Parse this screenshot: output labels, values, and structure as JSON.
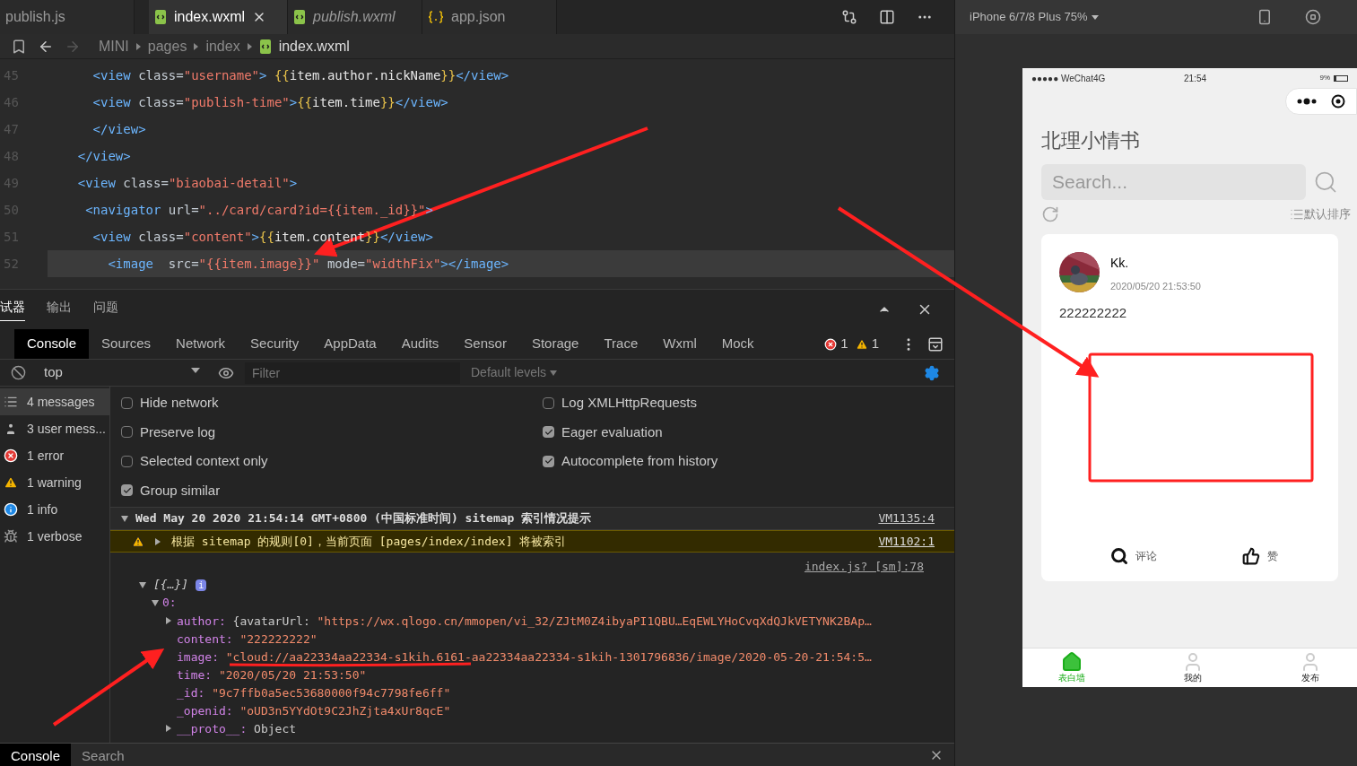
{
  "editor_tabs": [
    {
      "label": "publish.js",
      "kind": "js",
      "selected": false,
      "preview": false
    },
    {
      "label": "index.wxml",
      "kind": "wxml",
      "selected": true,
      "preview": false
    },
    {
      "label": "publish.wxml",
      "kind": "wxml",
      "selected": false,
      "preview": true
    },
    {
      "label": "app.json",
      "kind": "json",
      "selected": false,
      "preview": false
    }
  ],
  "breadcrumb": [
    "MINI",
    "pages",
    "index",
    "index.wxml"
  ],
  "code_lines": [
    {
      "number": "45",
      "highlighted": false,
      "segments": [
        {
          "text": "      <view",
          "kind": "tag"
        },
        {
          "text": " class=",
          "kind": "attr"
        },
        {
          "text": "\"username\"",
          "kind": "str"
        },
        {
          "text": "> ",
          "kind": "tag"
        },
        {
          "text": "{{",
          "kind": "brace"
        },
        {
          "text": "item.author.nickName",
          "kind": "plain"
        },
        {
          "text": "}}",
          "kind": "brace"
        },
        {
          "text": "</view>",
          "kind": "tag"
        }
      ]
    },
    {
      "number": "46",
      "highlighted": false,
      "segments": [
        {
          "text": "      <view",
          "kind": "tag"
        },
        {
          "text": " class=",
          "kind": "attr"
        },
        {
          "text": "\"publish-time\"",
          "kind": "str"
        },
        {
          "text": ">",
          "kind": "tag"
        },
        {
          "text": "{{",
          "kind": "brace"
        },
        {
          "text": "item.time",
          "kind": "plain"
        },
        {
          "text": "}}",
          "kind": "brace"
        },
        {
          "text": "</view>",
          "kind": "tag"
        }
      ]
    },
    {
      "number": "47",
      "highlighted": false,
      "segments": [
        {
          "text": "      </view>",
          "kind": "tag"
        }
      ]
    },
    {
      "number": "48",
      "highlighted": false,
      "segments": [
        {
          "text": "    </view>",
          "kind": "tag"
        }
      ]
    },
    {
      "number": "49",
      "highlighted": false,
      "segments": [
        {
          "text": "    <view",
          "kind": "tag"
        },
        {
          "text": " class=",
          "kind": "attr"
        },
        {
          "text": "\"biaobai-detail\"",
          "kind": "str"
        },
        {
          "text": ">",
          "kind": "tag"
        }
      ]
    },
    {
      "number": "50",
      "highlighted": false,
      "segments": [
        {
          "text": "     <navigator",
          "kind": "tag"
        },
        {
          "text": " url=",
          "kind": "attr"
        },
        {
          "text": "\"../card/card?id={{item._id}}\"",
          "kind": "str"
        },
        {
          "text": ">",
          "kind": "tag"
        }
      ]
    },
    {
      "number": "51",
      "highlighted": false,
      "segments": [
        {
          "text": "      <view",
          "kind": "tag"
        },
        {
          "text": " class=",
          "kind": "attr"
        },
        {
          "text": "\"content\"",
          "kind": "str"
        },
        {
          "text": ">",
          "kind": "tag"
        },
        {
          "text": "{{",
          "kind": "brace"
        },
        {
          "text": "item.content",
          "kind": "plain"
        },
        {
          "text": "}}",
          "kind": "brace"
        },
        {
          "text": "</view>",
          "kind": "tag"
        }
      ]
    },
    {
      "number": "52",
      "highlighted": true,
      "segments": [
        {
          "text": "        <image",
          "kind": "tag"
        },
        {
          "text": "  src=",
          "kind": "attr"
        },
        {
          "text": "\"{{item.image}}\"",
          "kind": "str"
        },
        {
          "text": " mode=",
          "kind": "attr"
        },
        {
          "text": "\"widthFix\"",
          "kind": "str"
        },
        {
          "text": "></image>",
          "kind": "tag"
        }
      ]
    }
  ],
  "panel_tabs": [
    {
      "label": "试器",
      "selected": true
    },
    {
      "label": "输出",
      "selected": false
    },
    {
      "label": "问题",
      "selected": false
    }
  ],
  "devtools_tabs": [
    {
      "label": "Console",
      "selected": true
    },
    {
      "label": "Sources",
      "selected": false
    },
    {
      "label": "Network",
      "selected": false
    },
    {
      "label": "Security",
      "selected": false
    },
    {
      "label": "AppData",
      "selected": false
    },
    {
      "label": "Audits",
      "selected": false
    },
    {
      "label": "Sensor",
      "selected": false
    },
    {
      "label": "Storage",
      "selected": false
    },
    {
      "label": "Trace",
      "selected": false
    },
    {
      "label": "Wxml",
      "selected": false
    },
    {
      "label": "Mock",
      "selected": false
    }
  ],
  "counts": {
    "errors": "1",
    "warnings": "1"
  },
  "toolbar": {
    "context": "top",
    "filter_placeholder": "Filter",
    "levels": "Default levels"
  },
  "sidebar": [
    {
      "label": "4 messages",
      "kind": "messages",
      "selected": true
    },
    {
      "label": "3 user mess...",
      "kind": "user",
      "selected": false
    },
    {
      "label": "1 error",
      "kind": "error",
      "selected": false
    },
    {
      "label": "1 warning",
      "kind": "warning",
      "selected": false
    },
    {
      "label": "1 info",
      "kind": "info",
      "selected": false
    },
    {
      "label": "1 verbose",
      "kind": "verbose",
      "selected": false
    }
  ],
  "settings_left": [
    {
      "label": "Hide network",
      "checked": false
    },
    {
      "label": "Preserve log",
      "checked": false
    },
    {
      "label": "Selected context only",
      "checked": false
    },
    {
      "label": "Group similar",
      "checked": true
    }
  ],
  "settings_right": [
    {
      "label": "Log XMLHttpRequests",
      "checked": false
    },
    {
      "label": "Eager evaluation",
      "checked": true
    },
    {
      "label": "Autocomplete from history",
      "checked": true
    }
  ],
  "group_header": {
    "text": "Wed May 20 2020 21:54:14 GMT+0800 (中国标准时间) sitemap 索引情况提示",
    "source": "VM1135:4",
    "expanded": true
  },
  "warning": {
    "text": "根据 sitemap 的规则[0]，当前页面 [pages/index/index] 将被索引",
    "source": "VM1102:1"
  },
  "log": {
    "source": "index.js? [sm]:78",
    "root": "[{…}]",
    "badge": "i",
    "index": "0:",
    "props": [
      {
        "key": "author:",
        "value": "{avatarUrl:",
        "string": "\"https://wx.qlogo.cn/mmopen/vi_32/ZJtM0Z4ibyaPI1QBU…EqEWLYHoCvqXdQJkVETYNK2BAp…",
        "expandable": true
      },
      {
        "key": "content:",
        "string": "\"222222222\"",
        "expandable": false
      },
      {
        "key": "image:",
        "string": "\"cloud://aa22334aa22334-s1kih.6161-aa22334aa22334-s1kih-1301796836/image/2020-05-20-21:54:5…",
        "expandable": false
      },
      {
        "key": "time:",
        "string": "\"2020/05/20 21:53:50\"",
        "expandable": false
      },
      {
        "key": "_id:",
        "string": "\"9c7ffb0a5ec53680000f94c7798fe6ff\"",
        "expandable": false
      },
      {
        "key": "_openid:",
        "string": "\"oUD3n5YYdOt9C2JhZjta4xUr8qcE\"",
        "expandable": false
      },
      {
        "key": "__proto__:",
        "value": "Object",
        "expandable": true
      }
    ]
  },
  "drawer_tabs": [
    {
      "label": "Console",
      "selected": true
    },
    {
      "label": "Search",
      "selected": false
    }
  ],
  "device": {
    "label": "iPhone 6/7/8 Plus 75%"
  },
  "phone": {
    "carrier": "●●●●● WeChat4G",
    "time": "21:54",
    "battery": "9%",
    "title": "北理小情书",
    "search_placeholder": "Search...",
    "sort": "默认排序",
    "post": {
      "author": "Kk.",
      "time": "2020/05/20 21:53:50",
      "content": "222222222",
      "actions": [
        {
          "label": "评论",
          "kind": "comment"
        },
        {
          "label": "赞",
          "kind": "like"
        }
      ]
    },
    "tabs": [
      {
        "label": "表白墙",
        "kind": "home",
        "selected": true
      },
      {
        "label": "我的",
        "kind": "user",
        "selected": false
      },
      {
        "label": "发布",
        "kind": "user",
        "selected": false
      }
    ]
  }
}
